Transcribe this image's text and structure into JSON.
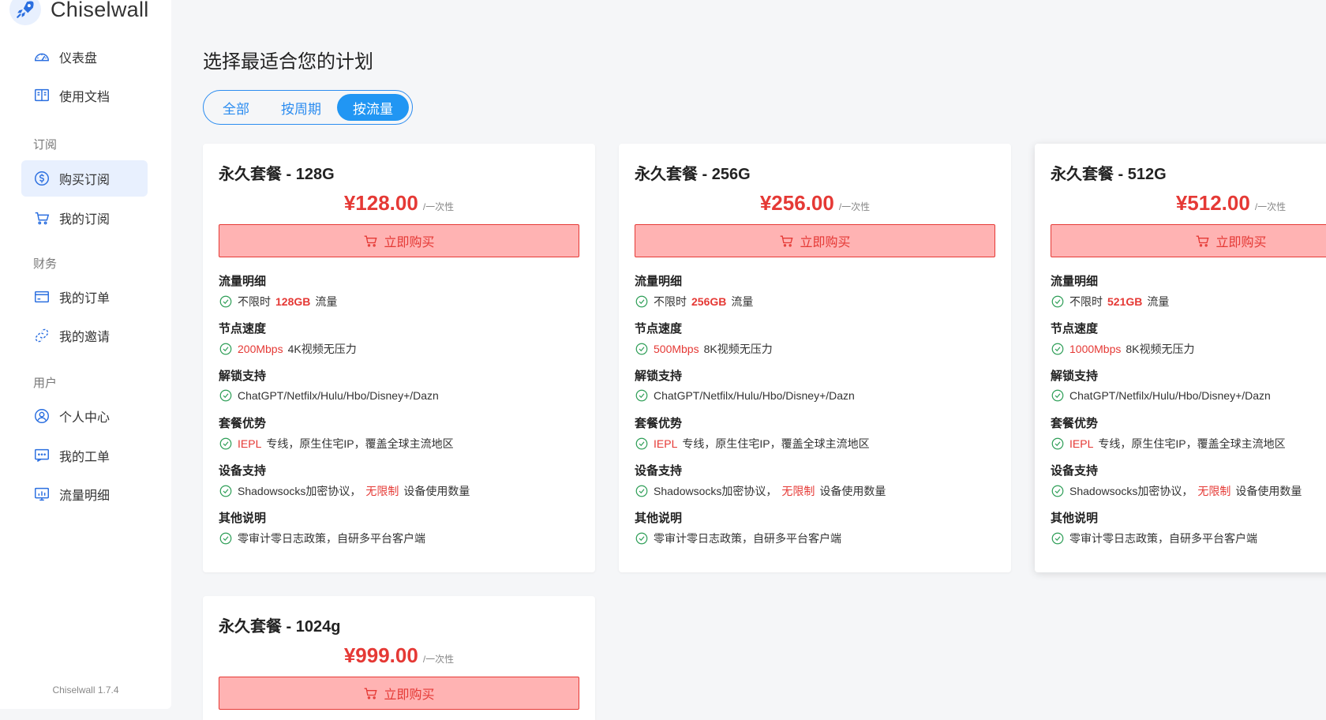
{
  "brand": {
    "name": "Chiselwall",
    "version": "Chiselwall 1.7.4"
  },
  "nav": {
    "dashboard": "仪表盘",
    "docs": "使用文档",
    "section_subscribe": "订阅",
    "buy_subscription": "购买订阅",
    "my_subscription": "我的订阅",
    "section_finance": "财务",
    "my_orders": "我的订单",
    "my_invites": "我的邀请",
    "section_user": "用户",
    "profile": "个人中心",
    "my_tickets": "我的工单",
    "traffic_detail": "流量明细"
  },
  "page": {
    "title": "选择最适合您的计划",
    "tabs": [
      {
        "label": "全部"
      },
      {
        "label": "按周期"
      },
      {
        "label": "按流量"
      }
    ]
  },
  "plans": [
    {
      "title": "永久套餐 - 128G",
      "price": "¥128.00",
      "unit": "/一次性",
      "buy_label": "立即购买",
      "traffic_head": "流量明细",
      "traffic_pre": "不限时",
      "traffic_val": "128GB",
      "traffic_post": "流量",
      "speed_head": "节点速度",
      "speed_val": "200Mbps",
      "speed_post": "4K视频无压力",
      "unlock_head": "解锁支持",
      "unlock_val": "ChatGPT/Netfilx/Hulu/Hbo/Disney+/Dazn",
      "adv_head": "套餐优势",
      "adv_red": "IEPL",
      "adv_post": "专线，原生住宅IP，覆盖全球主流地区",
      "device_head": "设备支持",
      "device_pre": "Shadowsocks加密协议，",
      "device_red": "无限制",
      "device_post": "设备使用数量",
      "other_head": "其他说明",
      "other_val": "零审计零日志政策，自研多平台客户端"
    },
    {
      "title": "永久套餐 - 256G",
      "price": "¥256.00",
      "unit": "/一次性",
      "buy_label": "立即购买",
      "traffic_head": "流量明细",
      "traffic_pre": "不限时",
      "traffic_val": "256GB",
      "traffic_post": "流量",
      "speed_head": "节点速度",
      "speed_val": "500Mbps",
      "speed_post": "8K视频无压力",
      "unlock_head": "解锁支持",
      "unlock_val": "ChatGPT/Netfilx/Hulu/Hbo/Disney+/Dazn",
      "adv_head": "套餐优势",
      "adv_red": "IEPL",
      "adv_post": "专线，原生住宅IP，覆盖全球主流地区",
      "device_head": "设备支持",
      "device_pre": "Shadowsocks加密协议，",
      "device_red": "无限制",
      "device_post": "设备使用数量",
      "other_head": "其他说明",
      "other_val": "零审计零日志政策，自研多平台客户端"
    },
    {
      "title": "永久套餐 - 512G",
      "price": "¥512.00",
      "unit": "/一次性",
      "buy_label": "立即购买",
      "traffic_head": "流量明细",
      "traffic_pre": "不限时",
      "traffic_val": "521GB",
      "traffic_post": "流量",
      "speed_head": "节点速度",
      "speed_val": "1000Mbps",
      "speed_post": "8K视频无压力",
      "unlock_head": "解锁支持",
      "unlock_val": "ChatGPT/Netfilx/Hulu/Hbo/Disney+/Dazn",
      "adv_head": "套餐优势",
      "adv_red": "IEPL",
      "adv_post": "专线，原生住宅IP，覆盖全球主流地区",
      "device_head": "设备支持",
      "device_pre": "Shadowsocks加密协议，",
      "device_red": "无限制",
      "device_post": "设备使用数量",
      "other_head": "其他说明",
      "other_val": "零审计零日志政策，自研多平台客户端"
    },
    {
      "title": "永久套餐 - 1024g",
      "price": "¥999.00",
      "unit": "/一次性",
      "buy_label": "立即购买"
    }
  ],
  "colors": {
    "accent": "#2196f3",
    "price_red": "#e53935",
    "button_bg": "#ffb3b3",
    "check_green": "#2e9e57"
  },
  "icons": {
    "logo": "rocket-icon",
    "dashboard": "gauge-icon",
    "docs": "book-icon",
    "buy": "dollar-circle-icon",
    "subscription": "cart-icon",
    "orders": "card-icon",
    "invites": "link-icon",
    "profile": "user-circle-icon",
    "tickets": "chat-icon",
    "traffic": "chart-icon",
    "check": "check-circle-icon",
    "buy_button": "cart-icon"
  }
}
